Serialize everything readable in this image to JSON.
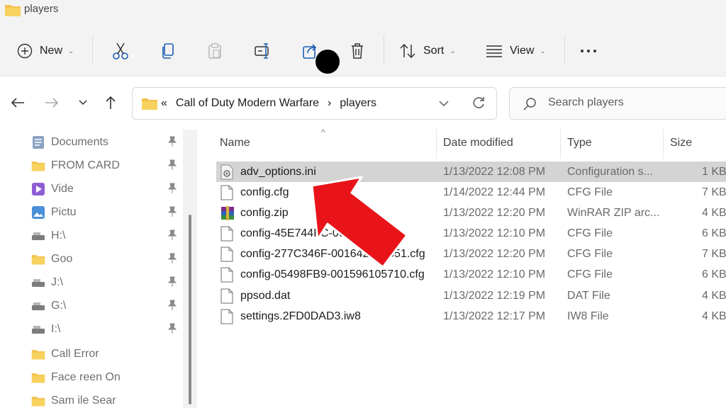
{
  "window": {
    "title": "players"
  },
  "toolbar": {
    "new_label": "New",
    "sort_label": "Sort",
    "view_label": "View",
    "icons": [
      "cut-icon",
      "copy-icon",
      "paste-icon",
      "rename-icon",
      "share-icon",
      "delete-icon",
      "more-icon"
    ]
  },
  "address": {
    "overflow": "«",
    "crumbs": [
      "Call of Duty Modern Warfare",
      "›",
      "players"
    ]
  },
  "search": {
    "placeholder": "Search players"
  },
  "sidebar": {
    "items": [
      {
        "label": "Documents",
        "icon": "documents-icon"
      },
      {
        "label": "FROM                    CARD",
        "icon": "folder-icon"
      },
      {
        "label": "Vide",
        "icon": "videos-icon"
      },
      {
        "label": "Pictu",
        "icon": "pictures-icon"
      },
      {
        "label": "H:\\",
        "icon": "drive-icon"
      },
      {
        "label": "Goo",
        "icon": "folder-icon"
      },
      {
        "label": "J:\\",
        "icon": "drive-icon"
      },
      {
        "label": "G:\\",
        "icon": "drive-icon"
      },
      {
        "label": "I:\\",
        "icon": "drive-icon"
      },
      {
        "label": "Call                      Error",
        "icon": "folder-icon"
      },
      {
        "label": "Face                 reen On",
        "icon": "folder-icon"
      },
      {
        "label": "Sam                  ile Sear",
        "icon": "folder-icon"
      }
    ]
  },
  "list": {
    "columns": {
      "name": "Name",
      "date": "Date modified",
      "type": "Type",
      "size": "Size"
    },
    "sort_indicator": "^",
    "rows": [
      {
        "name": "adv_options.ini",
        "date": "1/13/2022 12:08 PM",
        "type": "Configuration s...",
        "size": "1 KB",
        "icon": "settings-file-icon",
        "selected": true
      },
      {
        "name": "config.cfg",
        "date": "1/14/2022 12:44 PM",
        "type": "CFG File",
        "size": "7 KB",
        "icon": "file-icon"
      },
      {
        "name": "config.zip",
        "date": "1/13/2022 12:20 PM",
        "type": "WinRAR ZIP arc...",
        "size": "4 KB",
        "icon": "winrar-icon"
      },
      {
        "name": "config-45E744FC-0015951     .cfg",
        "date": "1/13/2022 12:10 PM",
        "type": "CFG File",
        "size": "6 KB",
        "icon": "file-icon"
      },
      {
        "name": "config-277C346F-001642047651.cfg",
        "date": "1/13/2022 12:20 PM",
        "type": "CFG File",
        "size": "7 KB",
        "icon": "file-icon"
      },
      {
        "name": "config-05498FB9-001596105710.cfg",
        "date": "1/13/2022 12:10 PM",
        "type": "CFG File",
        "size": "6 KB",
        "icon": "file-icon"
      },
      {
        "name": "ppsod.dat",
        "date": "1/13/2022 12:19 PM",
        "type": "DAT File",
        "size": "4 KB",
        "icon": "file-icon"
      },
      {
        "name": "settings.2FD0DAD3.iw8",
        "date": "1/13/2022 12:17 PM",
        "type": "IW8 File",
        "size": "4 KB",
        "icon": "file-icon"
      }
    ]
  },
  "colors": {
    "arrow": "#e8141a",
    "folder": "#f3c24f",
    "selected_row": "#d4d4d4"
  }
}
